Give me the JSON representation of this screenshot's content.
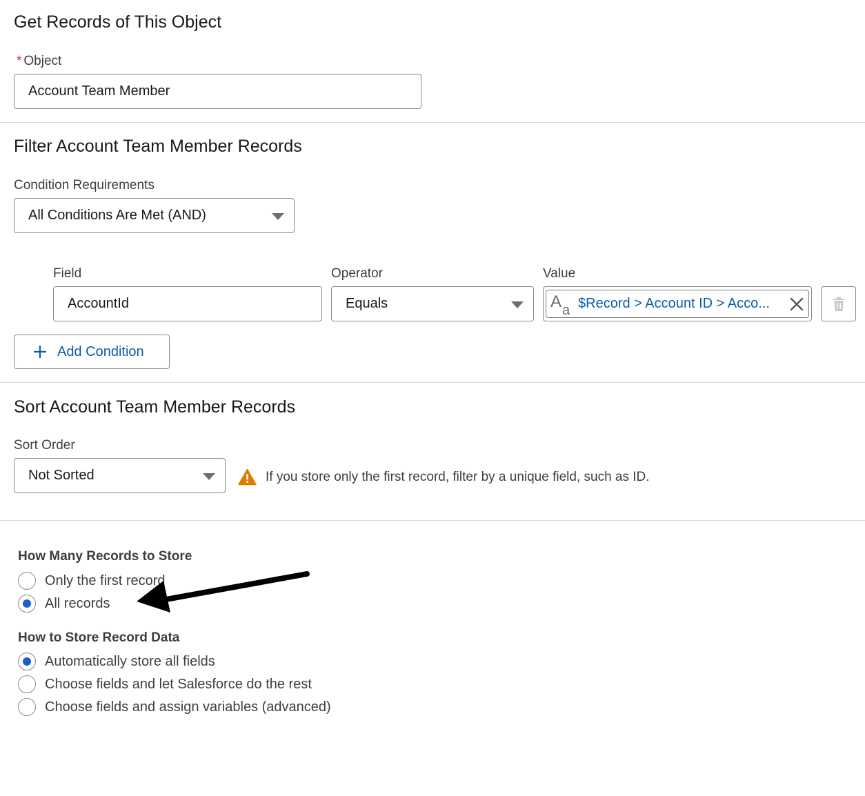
{
  "get_records": {
    "title": "Get Records of This Object",
    "object_required_mark": "*",
    "object_label": "Object",
    "object_value": "Account Team Member"
  },
  "filter": {
    "title": "Filter Account Team Member Records",
    "condition_requirements_label": "Condition Requirements",
    "condition_requirements_value": "All Conditions Are Met (AND)",
    "field_label": "Field",
    "operator_label": "Operator",
    "value_label": "Value",
    "condition": {
      "field": "AccountId",
      "operator": "Equals",
      "value": "$Record > Account ID > Acco...",
      "value_icon": "text-type-icon"
    },
    "add_condition_label": "Add Condition"
  },
  "sort": {
    "title": "Sort Account Team Member Records",
    "sort_order_label": "Sort Order",
    "sort_order_value": "Not Sorted",
    "warning_text": "If you store only the first record, filter by a unique field, such as ID."
  },
  "how_many": {
    "label": "How Many Records to Store",
    "options": [
      {
        "label": "Only the first record",
        "checked": false
      },
      {
        "label": "All records",
        "checked": true
      }
    ]
  },
  "how_to_store": {
    "label": "How to Store Record Data",
    "options": [
      {
        "label": "Automatically store all fields",
        "checked": true
      },
      {
        "label": "Choose fields and let Salesforce do the rest",
        "checked": false
      },
      {
        "label": "Choose fields and assign variables (advanced)",
        "checked": false
      }
    ]
  },
  "colors": {
    "accent_blue": "#0b5cab",
    "radio_blue": "#1b5fc8",
    "required_red": "#c23934",
    "warning_orange": "#dd7a01",
    "divider": "#d8d8d8"
  }
}
